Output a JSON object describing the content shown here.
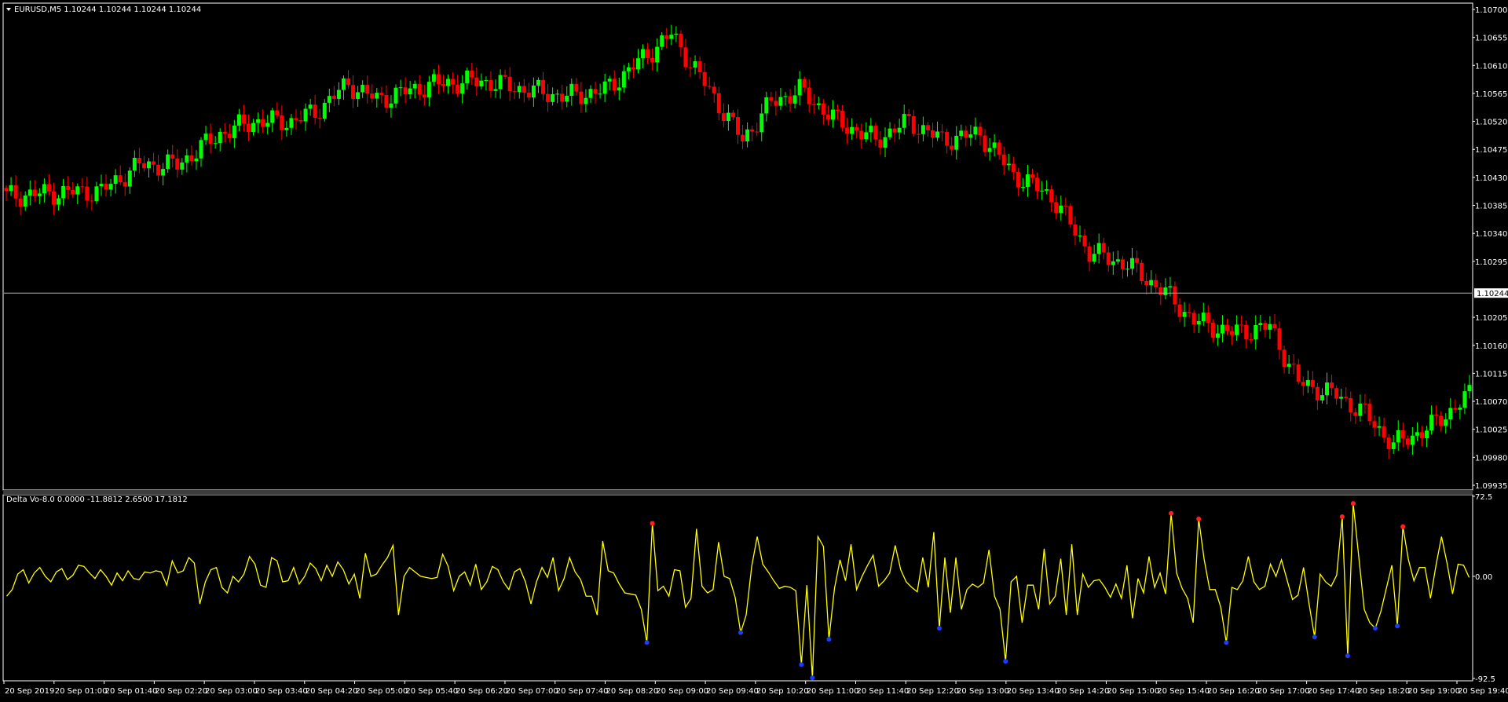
{
  "main_header": "EURUSD,M5  1.10244 1.10244 1.10244 1.10244",
  "indicator_header": "Delta Vo-8.0 0.0000 -11.8812 2.6500 17.1812",
  "current_price_label": "1.10244",
  "colors": {
    "background": "#000000",
    "frame": "#ffffff",
    "bull": "#00ff00",
    "bear": "#ff0000",
    "bid_line": "#a9b8c9",
    "indicator_line": "#ffff00",
    "peak_marker": "#ff2020",
    "trough_marker": "#1a3cff",
    "text": "#ffffff"
  },
  "chart_data": [
    {
      "type": "candlestick",
      "symbol": "EURUSD",
      "timeframe": "M5",
      "ylim": [
        1.09935,
        1.107
      ],
      "y_ticks": [
        "1.10700",
        "1.10655",
        "1.10610",
        "1.10565",
        "1.10520",
        "1.10475",
        "1.10430",
        "1.10385",
        "1.10340",
        "1.10295",
        "1.10244",
        "1.10205",
        "1.10160",
        "1.10115",
        "1.10070",
        "1.10025",
        "1.09980",
        "1.09935"
      ],
      "current_price": 1.10244,
      "x_ticks": [
        "20 Sep 2019",
        "20 Sep 01:00",
        "20 Sep 01:40",
        "20 Sep 02:20",
        "20 Sep 03:00",
        "20 Sep 03:40",
        "20 Sep 04:20",
        "20 Sep 05:00",
        "20 Sep 05:40",
        "20 Sep 06:20",
        "20 Sep 07:00",
        "20 Sep 07:40",
        "20 Sep 08:20",
        "20 Sep 09:00",
        "20 Sep 09:40",
        "20 Sep 10:20",
        "20 Sep 11:00",
        "20 Sep 11:40",
        "20 Sep 12:20",
        "20 Sep 13:00",
        "20 Sep 13:40",
        "20 Sep 14:20",
        "20 Sep 15:00",
        "20 Sep 15:40",
        "20 Sep 16:20",
        "20 Sep 17:00",
        "20 Sep 17:40",
        "20 Sep 18:20",
        "20 Sep 19:00",
        "20 Sep 19:40"
      ],
      "close_anchors": [
        [
          0,
          1.104
        ],
        [
          10,
          1.10405
        ],
        [
          20,
          1.10408
        ],
        [
          28,
          1.1045
        ],
        [
          36,
          1.1045
        ],
        [
          45,
          1.105
        ],
        [
          52,
          1.1052
        ],
        [
          60,
          1.1052
        ],
        [
          65,
          1.10535
        ],
        [
          72,
          1.1058
        ],
        [
          78,
          1.10555
        ],
        [
          90,
          1.1058
        ],
        [
          100,
          1.10585
        ],
        [
          110,
          1.1057
        ],
        [
          118,
          1.1056
        ],
        [
          126,
          1.1057
        ],
        [
          133,
          1.10615
        ],
        [
          140,
          1.1066
        ],
        [
          148,
          1.1057
        ],
        [
          155,
          1.1049
        ],
        [
          161,
          1.1055
        ],
        [
          167,
          1.1057
        ],
        [
          175,
          1.1052
        ],
        [
          183,
          1.1049
        ],
        [
          190,
          1.1052
        ],
        [
          197,
          1.1049
        ],
        [
          205,
          1.105
        ],
        [
          212,
          1.10435
        ],
        [
          220,
          1.104
        ],
        [
          228,
          1.1031
        ],
        [
          236,
          1.1029
        ],
        [
          244,
          1.10244
        ],
        [
          250,
          1.102
        ],
        [
          258,
          1.1018
        ],
        [
          266,
          1.1019
        ],
        [
          272,
          1.101
        ],
        [
          280,
          1.1008
        ],
        [
          286,
          1.1005
        ],
        [
          292,
          1.1
        ],
        [
          300,
          1.1003
        ],
        [
          308,
          1.1008
        ]
      ]
    },
    {
      "type": "line",
      "name": "Delta Vo-8.0",
      "ylim": [
        -92.5,
        72.5
      ],
      "y_ticks": [
        "72.5",
        "0.00",
        "-92.5"
      ],
      "values": [
        -18,
        -12,
        2,
        6,
        -6,
        3,
        8,
        0,
        -5,
        4,
        7,
        -3,
        1,
        10,
        9,
        3,
        -2,
        6,
        0,
        -8,
        3,
        -4,
        5,
        -2,
        -3,
        4,
        3,
        5,
        4,
        -8,
        14,
        3,
        5,
        17,
        12,
        -25,
        -5,
        6,
        8,
        -10,
        -15,
        0,
        -5,
        2,
        18,
        11,
        -8,
        -10,
        17,
        14,
        -5,
        -4,
        8,
        -7,
        0,
        12,
        7,
        -4,
        10,
        0,
        13,
        6,
        -7,
        2,
        -20,
        21,
        0,
        2,
        10,
        17,
        28,
        -35,
        0,
        8,
        4,
        0,
        -1,
        -2,
        -1,
        20,
        9,
        -13,
        0,
        4,
        -8,
        11,
        -12,
        -5,
        9,
        6,
        -5,
        -12,
        4,
        7,
        -5,
        -25,
        -5,
        8,
        -1,
        17,
        -13,
        -2,
        17,
        4,
        -3,
        -18,
        -18,
        -35,
        32,
        5,
        3,
        -7,
        -15,
        -16,
        -17,
        -30,
        -60,
        48,
        -13,
        -9,
        -18,
        6,
        5,
        -28,
        -20,
        43,
        -9,
        -15,
        -12,
        31,
        0,
        -2,
        -19,
        -51,
        -35,
        9,
        36,
        11,
        4,
        -4,
        -11,
        -9,
        -10,
        -13,
        -80,
        -8,
        -92,
        36,
        27,
        -57,
        -11,
        15,
        -4,
        29,
        -12,
        0,
        10,
        19,
        -9,
        -4,
        3,
        28,
        6,
        -5,
        -10,
        -14,
        17,
        -10,
        40,
        -47,
        17,
        -33,
        17,
        -30,
        -12,
        -7,
        -10,
        -6,
        24,
        -18,
        -30,
        -77,
        -5,
        0,
        -42,
        -8,
        -8,
        -30,
        25,
        -25,
        -18,
        16,
        -35,
        29,
        -35,
        2,
        -10,
        -4,
        -3,
        -10,
        -19,
        -7,
        -20,
        10,
        -38,
        -2,
        -15,
        18,
        -10,
        3,
        -16,
        57,
        3,
        -11,
        -20,
        -42,
        52,
        15,
        -12,
        -12,
        -28,
        -60,
        -10,
        -12,
        -4,
        18,
        -5,
        -12,
        -9,
        11,
        0,
        15,
        -3,
        -21,
        -17,
        8,
        -25,
        -55,
        2,
        -5,
        -9,
        1,
        54,
        -72,
        66,
        18,
        -30,
        -42,
        -47,
        -32,
        -11,
        10,
        -45,
        45,
        15,
        -4,
        8,
        8,
        -20,
        10,
        36,
        12,
        -16,
        11,
        10,
        -1
      ]
    }
  ]
}
